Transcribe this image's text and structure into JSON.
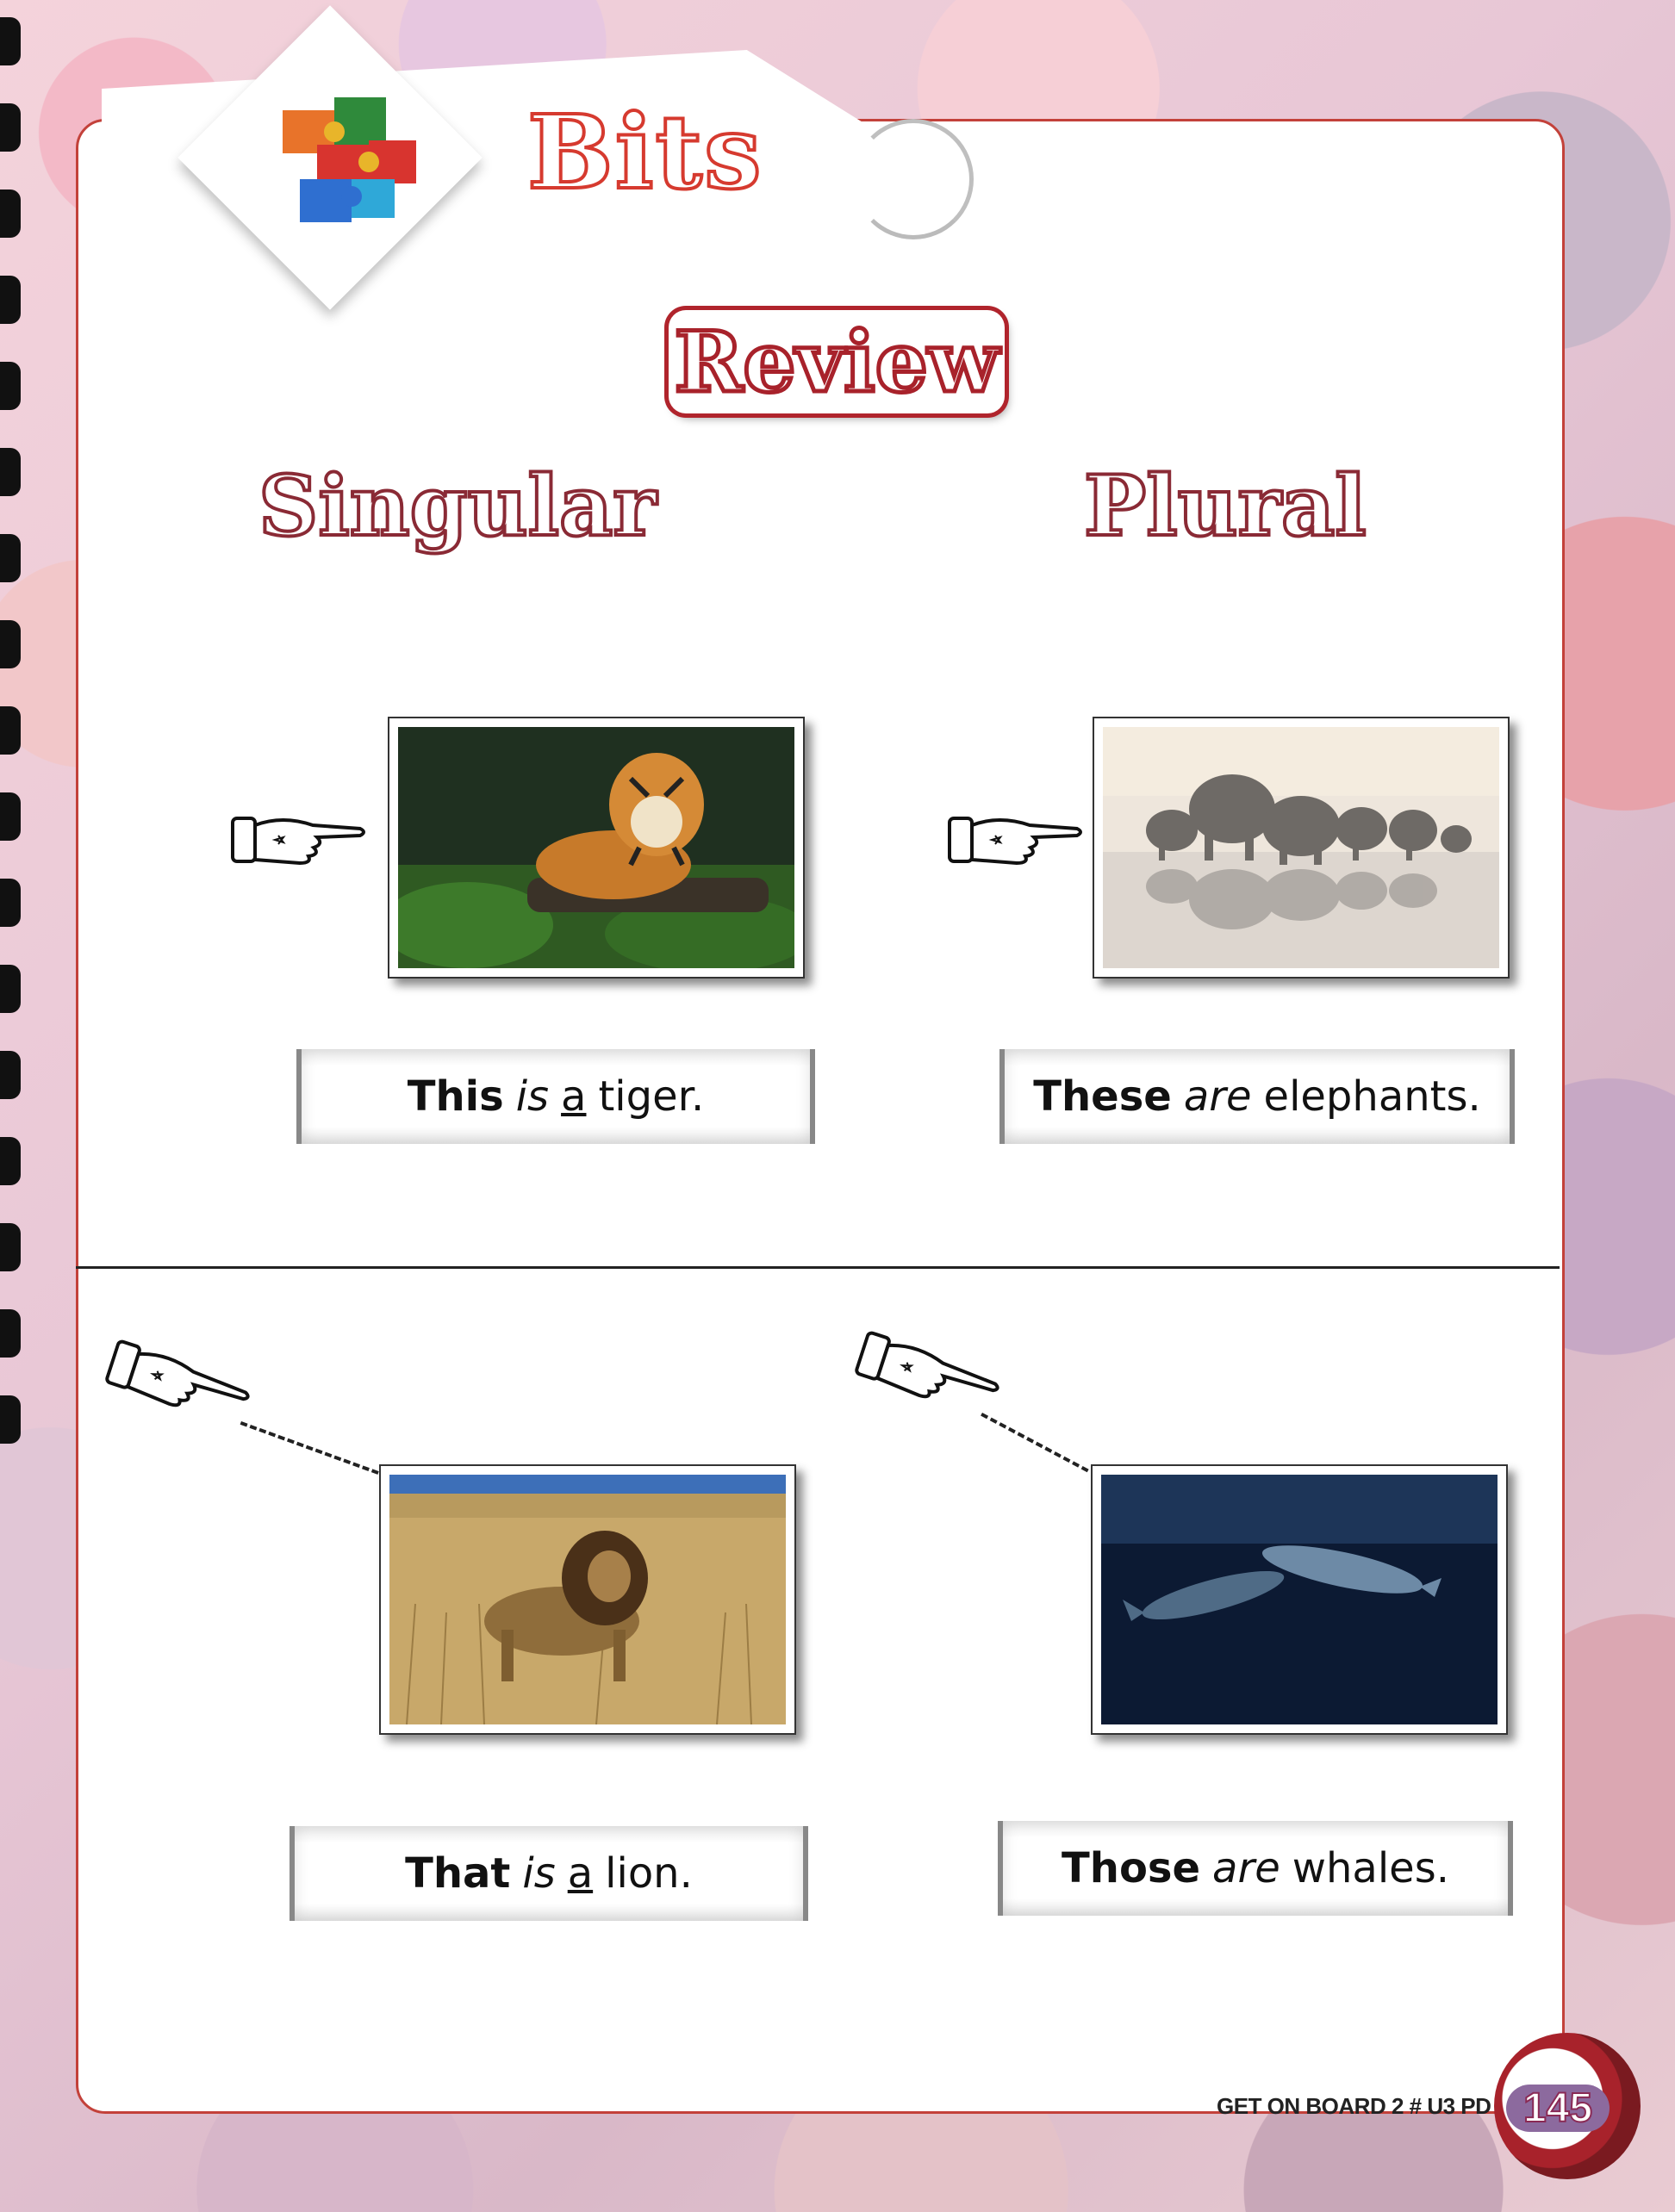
{
  "header": {
    "section_title": "Bits",
    "subtitle": "Review"
  },
  "columns": {
    "left": "Singular",
    "right": "Plural"
  },
  "examples": [
    {
      "image": "tiger-photo",
      "subject": "This",
      "verb": "is",
      "article": "a",
      "rest": "tiger."
    },
    {
      "image": "elephants-photo",
      "subject": "These",
      "verb": "are",
      "article": "",
      "rest": "elephants."
    },
    {
      "image": "lion-photo",
      "subject": "That",
      "verb": "is",
      "article": "a",
      "rest": "lion."
    },
    {
      "image": "whales-photo",
      "subject": "Those",
      "verb": "are",
      "article": "",
      "rest": "whales."
    }
  ],
  "footer": {
    "book": "GET ON BOARD 2 # U3 PD",
    "page": "145"
  },
  "colors": {
    "accent_red": "#c3413a",
    "review_red": "#a8222b",
    "heading_outline": "#8a2a35"
  }
}
